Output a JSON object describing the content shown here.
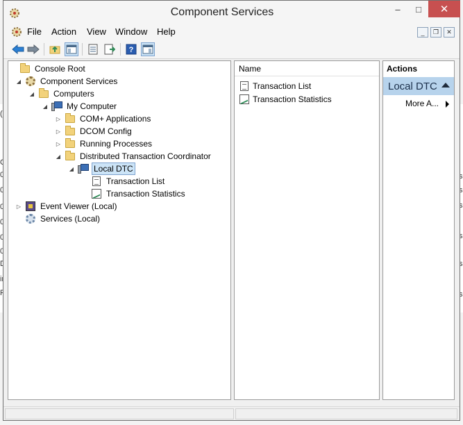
{
  "window": {
    "title": "Component Services"
  },
  "window_controls": {
    "minimize": "–",
    "maximize": "□",
    "close": "✕"
  },
  "menubar": {
    "items": [
      "File",
      "Action",
      "View",
      "Window",
      "Help"
    ]
  },
  "mdi_controls": {
    "minimize": "_",
    "restore": "❐",
    "close": "✕"
  },
  "toolbar": {
    "buttons": [
      "back-icon",
      "forward-icon",
      "up-folder-icon",
      "show-hide-console-tree-icon",
      "export-list-icon",
      "properties-icon",
      "help-icon",
      "show-hide-action-pane-icon"
    ]
  },
  "tree": {
    "items": [
      {
        "label": "Console Root",
        "icon": "folder-icon",
        "expander": ""
      },
      {
        "label": "Component Services",
        "icon": "component-services-icon",
        "expander": "◢"
      },
      {
        "label": "Computers",
        "icon": "folder-icon",
        "expander": "◢"
      },
      {
        "label": "My Computer",
        "icon": "computer-icon",
        "expander": "◢"
      },
      {
        "label": "COM+ Applications",
        "icon": "folder-icon",
        "expander": "▷"
      },
      {
        "label": "DCOM Config",
        "icon": "folder-icon",
        "expander": "▷"
      },
      {
        "label": "Running Processes",
        "icon": "folder-icon",
        "expander": "▷"
      },
      {
        "label": "Distributed Transaction Coordinator",
        "icon": "folder-icon",
        "expander": "◢"
      },
      {
        "label": "Local DTC",
        "icon": "computer-icon",
        "expander": "◢",
        "selected": true
      },
      {
        "label": "Transaction List",
        "icon": "transaction-list-icon",
        "expander": ""
      },
      {
        "label": "Transaction Statistics",
        "icon": "transaction-statistics-icon",
        "expander": ""
      },
      {
        "label": "Event Viewer (Local)",
        "icon": "event-viewer-icon",
        "expander": "▷"
      },
      {
        "label": "Services (Local)",
        "icon": "services-icon",
        "expander": ""
      }
    ]
  },
  "list": {
    "header": "Name",
    "items": [
      {
        "label": "Transaction List",
        "icon": "transaction-list-icon"
      },
      {
        "label": "Transaction Statistics",
        "icon": "transaction-statistics-icon"
      }
    ]
  },
  "actions": {
    "header": "Actions",
    "section": "Local DTC",
    "more": "More A..."
  },
  "background_glyphs": {
    "left": [
      "(",
      "C",
      "0",
      "0",
      "0",
      "0",
      "0",
      "0",
      "D",
      "ir",
      "R"
    ],
    "right": [
      "s",
      "s",
      "s",
      "s",
      "s",
      "s"
    ]
  },
  "colors": {
    "accent_selection": "#cce4f7",
    "actions_section": "#b7d3ec",
    "close_button": "#c75050"
  }
}
